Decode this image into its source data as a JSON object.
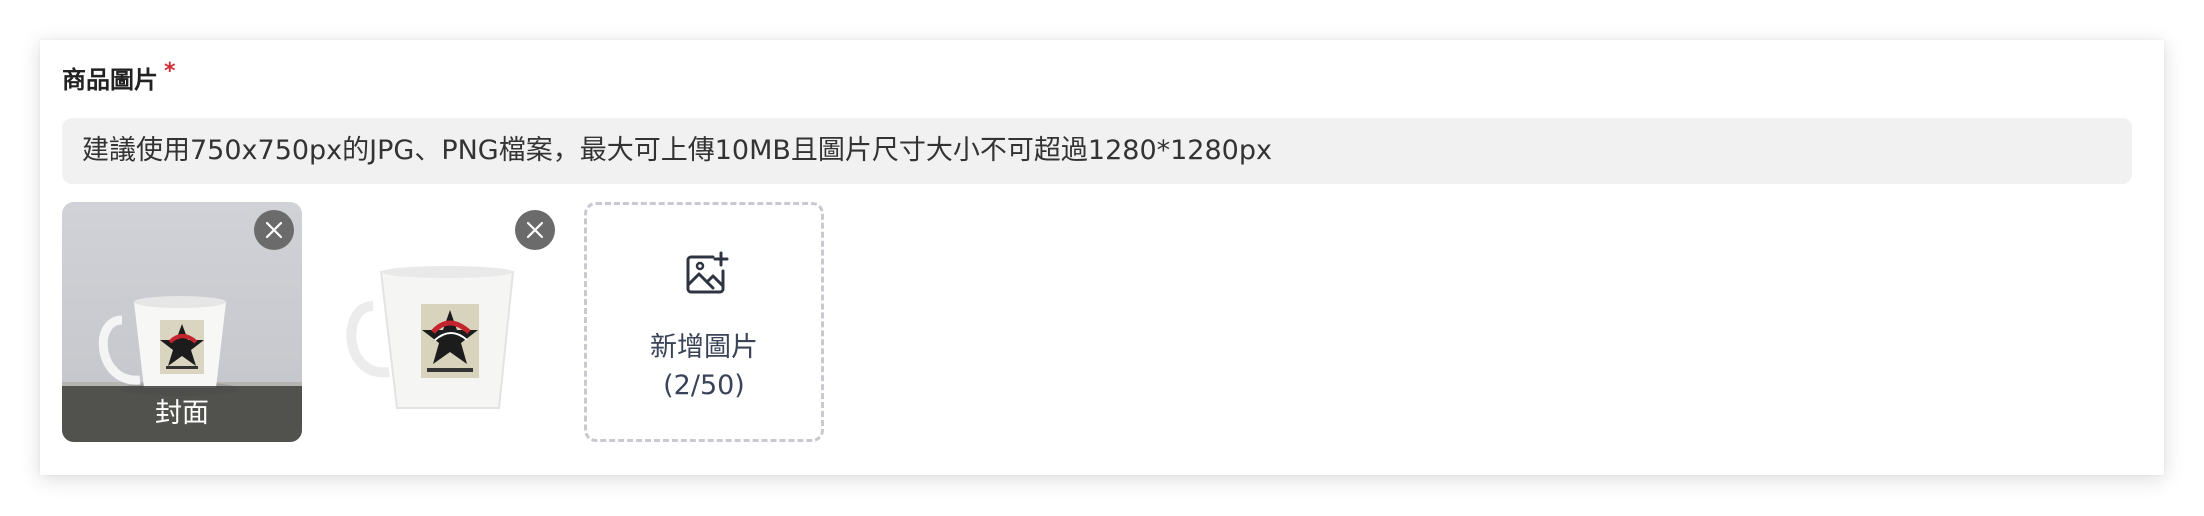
{
  "field": {
    "label": "商品圖片",
    "required_mark": "*"
  },
  "hint": {
    "text": "建議使用750x750px的JPG、PNG檔案，最大可上傳10MB且圖片尺寸大小不可超過1280*1280px"
  },
  "images": [
    {
      "alt": "mug-photo-1",
      "badge": "封面",
      "remove_icon": "close-icon"
    },
    {
      "alt": "mug-photo-2",
      "remove_icon": "close-icon"
    }
  ],
  "add_tile": {
    "icon": "image-add-icon",
    "label": "新增圖片",
    "count": "(2/50)"
  },
  "colors": {
    "required": "#d22b35",
    "hint_bg": "#f1f1f1",
    "remove_btn": "#6b6b6b",
    "dashed_border": "#c9c9d2"
  }
}
